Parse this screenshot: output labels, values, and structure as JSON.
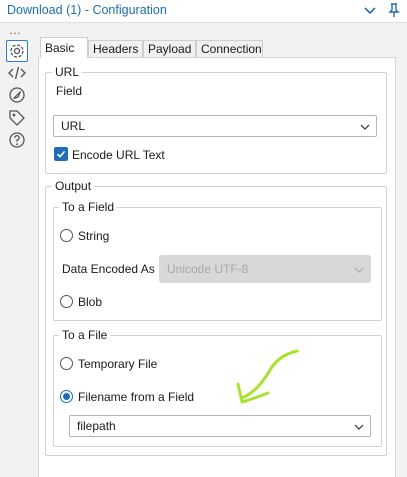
{
  "window": {
    "title": "Download (1) - Configuration",
    "icons": [
      "chevron-down-icon",
      "pin-icon"
    ]
  },
  "sidebar": {
    "overflow": "…",
    "icons": [
      "gear-icon",
      "code-icon",
      "navigate-icon",
      "tag-icon",
      "help-icon"
    ],
    "active_color": "#2b7cd3"
  },
  "tabs": [
    {
      "label": "Basic",
      "active": true
    },
    {
      "label": "Headers",
      "active": false
    },
    {
      "label": "Payload",
      "active": false
    },
    {
      "label": "Connection",
      "active": false
    }
  ],
  "url_group": {
    "legend": "URL",
    "field_label": "Field",
    "field_value": "URL",
    "encode_label": "Encode URL Text",
    "encode_checked": true
  },
  "output_group": {
    "legend": "Output",
    "to_field": {
      "legend": "To a Field",
      "string_label": "String",
      "encoded_as_label": "Data Encoded As",
      "encoded_as_value": "Unicode UTF-8",
      "blob_label": "Blob"
    },
    "to_file": {
      "legend": "To a File",
      "temporary_label": "Temporary File",
      "filename_label": "Filename from a Field",
      "filename_selected": true,
      "filename_value": "filepath"
    }
  },
  "colors": {
    "accent": "#1f6fb5",
    "title": "#1b6fb3",
    "annotation": "#a6e22e"
  }
}
